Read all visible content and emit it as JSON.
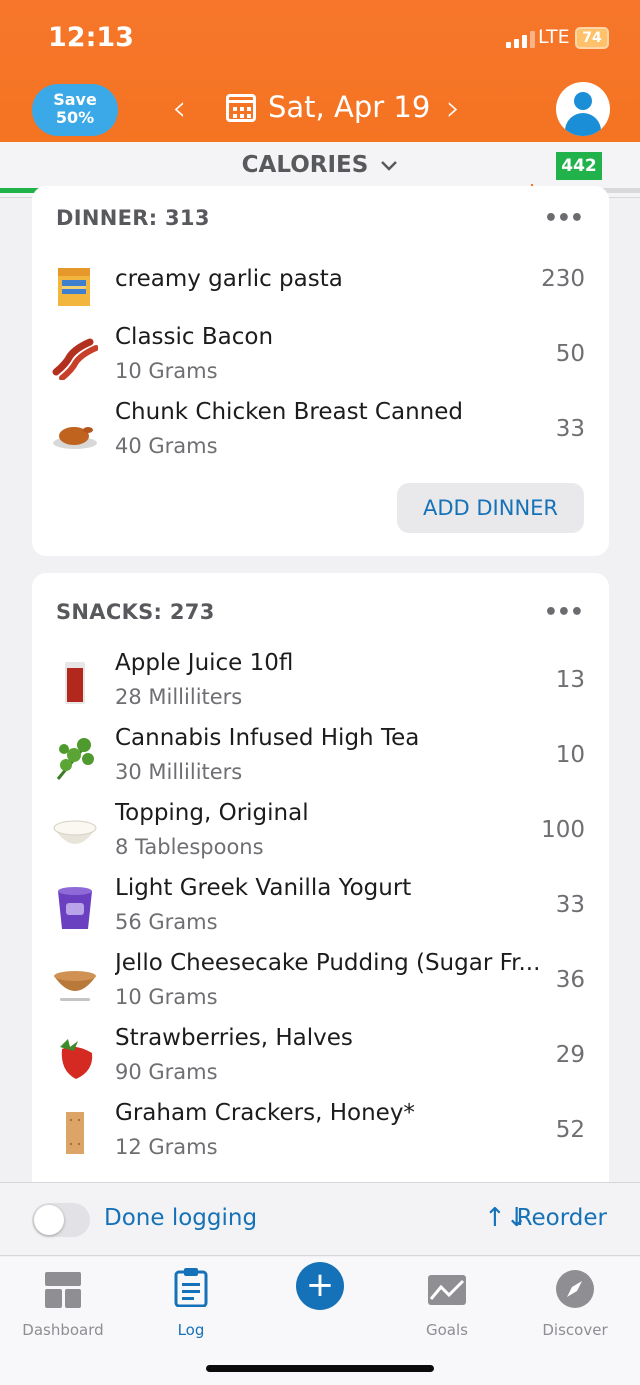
{
  "status": {
    "time": "12:13",
    "network": "LTE",
    "battery": "74"
  },
  "header": {
    "promo": {
      "line1": "Save",
      "line2": "50%"
    },
    "prev": "‹",
    "next": "›",
    "date": "Sat, Apr 19"
  },
  "calories": {
    "label": "CALORIES",
    "remaining": "442",
    "progress_fraction": 0.61
  },
  "dinner": {
    "title": "DINNER: 313",
    "more": "•••",
    "items": [
      {
        "name": "creamy garlic pasta",
        "amount": "",
        "calories": "230",
        "icon": "food-box-icon"
      },
      {
        "name": "Classic Bacon",
        "amount": "10 Grams",
        "calories": "50",
        "icon": "bacon-icon"
      },
      {
        "name": "Chunk Chicken Breast Canned",
        "amount": "40 Grams",
        "calories": "33",
        "icon": "roast-chicken-icon"
      }
    ],
    "add_label": "ADD DINNER"
  },
  "snacks": {
    "title": "SNACKS: 273",
    "more": "•••",
    "items": [
      {
        "name": "Apple Juice 10fl",
        "amount": "28 Milliliters",
        "calories": "13",
        "icon": "juice-glass-icon"
      },
      {
        "name": "Cannabis Infused High Tea",
        "amount": "30 Milliliters",
        "calories": "10",
        "icon": "herb-icon"
      },
      {
        "name": "Topping, Original",
        "amount": "8 Tablespoons",
        "calories": "100",
        "icon": "cream-bowl-icon"
      },
      {
        "name": "Light Greek Vanilla Yogurt",
        "amount": "56 Grams",
        "calories": "33",
        "icon": "yogurt-cup-icon"
      },
      {
        "name": "Jello Cheesecake Pudding (Sugar Fr...",
        "amount": "10 Grams",
        "calories": "36",
        "icon": "pudding-bowl-icon"
      },
      {
        "name": "Strawberries, Halves",
        "amount": "90 Grams",
        "calories": "29",
        "icon": "strawberry-icon"
      },
      {
        "name": "Graham Crackers, Honey*",
        "amount": "12 Grams",
        "calories": "52",
        "icon": "cracker-icon"
      }
    ]
  },
  "footer": {
    "done_label": "Done logging",
    "reorder_label": "Reorder",
    "reorder_icon": "↑↓"
  },
  "tabs": [
    {
      "label": "Dashboard",
      "icon": "dashboard-icon"
    },
    {
      "label": "Log",
      "icon": "log-clipboard-icon"
    },
    {
      "label": "",
      "icon": "plus-icon"
    },
    {
      "label": "Goals",
      "icon": "goals-icon"
    },
    {
      "label": "Discover",
      "icon": "discover-compass-icon"
    }
  ],
  "colors": {
    "header": "#f47422",
    "accent": "#1672b8",
    "success": "#22b24c"
  }
}
